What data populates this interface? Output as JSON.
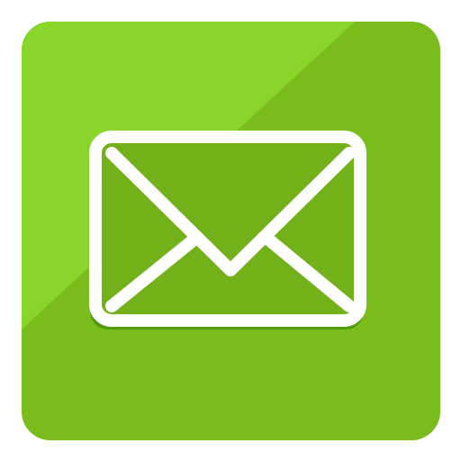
{
  "icon": {
    "name": "mail-icon",
    "colors": {
      "tile_light": "#8AD52A",
      "tile_dark": "#79BC1B",
      "envelope_fill": "#73B11B",
      "envelope_shadow": "#4E9B0C",
      "stroke": "#FFFFFF"
    }
  }
}
